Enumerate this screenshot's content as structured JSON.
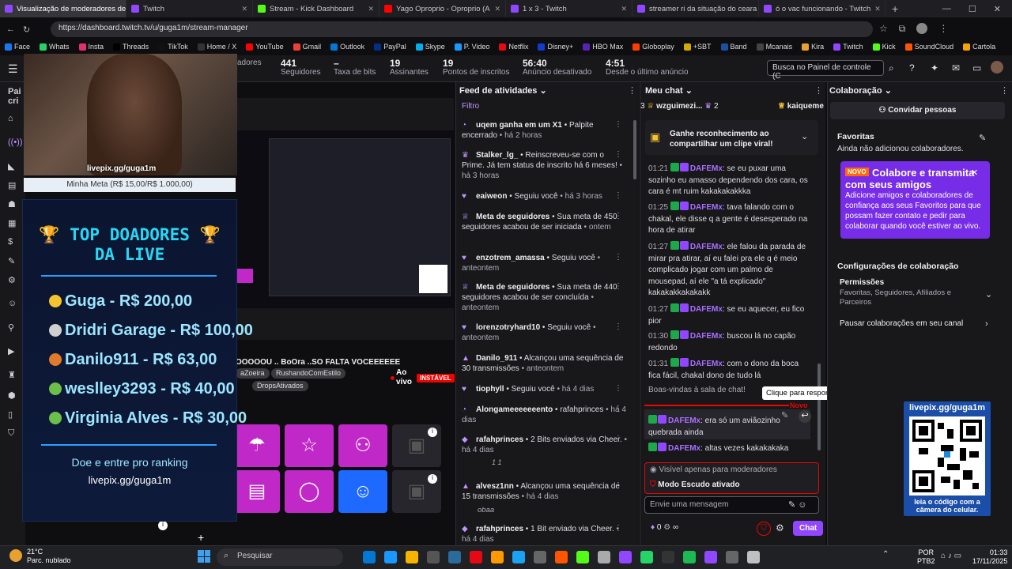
{
  "browser": {
    "tabs": [
      {
        "title": "Visualização de moderadores de",
        "color": "#9147ff",
        "active": true
      },
      {
        "title": "Twitch",
        "color": "#9147ff"
      },
      {
        "title": "Stream - Kick Dashboard",
        "color": "#53fc18"
      },
      {
        "title": "Yago Oproprio - Oproprio (A",
        "color": "#ff0000"
      },
      {
        "title": "1 x 3 - Twitch",
        "color": "#9147ff"
      },
      {
        "title": "streamer ri da situação do ceara",
        "color": "#9147ff"
      },
      {
        "title": "ó o vac funcionando - Twitch",
        "color": "#9147ff"
      }
    ],
    "url": "https://dashboard.twitch.tv/u/guga1m/stream-manager",
    "bookmarks": [
      "Face",
      "Whats",
      "Insta",
      "Threads",
      "TikTok",
      "Home / X",
      "YouTube",
      "Gmail",
      "Outlook",
      "PayPal",
      "Skype",
      "P. Video",
      "Netflix",
      "Disney+",
      "HBO Max",
      "Globoplay",
      "+SBT",
      "Band",
      "Mcanais",
      "Kira",
      "Twitch",
      "Kick",
      "SoundCloud",
      "Cartola"
    ]
  },
  "header": {
    "stats": [
      {
        "value": "",
        "label": "adores"
      },
      {
        "value": "441",
        "label": "Seguidores"
      },
      {
        "value": "–",
        "label": "Taxa de bits"
      },
      {
        "value": "19",
        "label": "Assinantes"
      },
      {
        "value": "19",
        "label": "Pontos de inscritos"
      },
      {
        "value": "56:40",
        "label": "Anúncio desativado"
      },
      {
        "value": "4:51",
        "label": "Desde o último anúncio"
      }
    ],
    "search_placeholder": "Busca no Painel de controle (C"
  },
  "overlay": {
    "cam_text": "livepix.gg/guga1m",
    "meta": "Minha Meta (R$ 15,00/R$ 1.000,00)",
    "donors_title_1": "🏆 TOP DOADORES 🏆",
    "donors_title_2": "DA LIVE",
    "donors": [
      {
        "text": "Guga - R$ 200,00",
        "medal": "#f4c430"
      },
      {
        "text": "Dridri Garage - R$ 100,00",
        "medal": "#cfcfcf"
      },
      {
        "text": "Danilo911 - R$ 63,00",
        "medal": "#e07b2a"
      },
      {
        "text": "weslley3293 - R$ 40,00",
        "medal": "#6cc04a"
      },
      {
        "text": "Virginia Alves - R$ 30,00",
        "medal": "#6cc04a"
      }
    ],
    "footer_1": "Doe e entre pro ranking",
    "footer_2": "livepix.gg/guga1m"
  },
  "preview": {
    "title": "OOOOOU .. BoOra ..SO FALTA VOCEEEEEE",
    "tags": [
      "aZoeira",
      "RushandoComEstilo",
      "DropsAtivados"
    ],
    "live": "Ao vivo",
    "unstable": "INSTÁVEL"
  },
  "feed": {
    "title": "Feed de atividades",
    "filter": "Filtro",
    "items": [
      {
        "icon": "◔",
        "user": "uqem ganha em um X1",
        "text": " • Palpite encerrado",
        "time": " • há 2 horas"
      },
      {
        "icon": "♛",
        "user": "Stalker_lg_",
        "text": " • Reinscreveu-se com o Prime. Já tem status de inscrito há 6 meses!",
        "time": " • há 3 horas"
      },
      {
        "icon": "♥",
        "user": "eaiweon",
        "text": " • Seguiu você",
        "time": " • há 3 horas"
      },
      {
        "icon": "♕",
        "user": "Meta de seguidores",
        "text": " • Sua meta de 450 seguidores acabou de ser iniciada",
        "time": " • ontem"
      },
      {
        "icon": "♥",
        "user": "enzotrem_amassa",
        "text": " • Seguiu você",
        "time": " • anteontem"
      },
      {
        "icon": "♕",
        "user": "Meta de seguidores",
        "text": " • Sua meta de 440 seguidores acabou de ser concluída",
        "time": " • anteontem"
      },
      {
        "icon": "♥",
        "user": "lorenzotryhard10",
        "text": " • Seguiu você",
        "time": " • anteontem"
      },
      {
        "icon": "▲",
        "user": "Danilo_911",
        "text": " • Alcançou uma sequência de 30 transmissões",
        "time": " • anteontem"
      },
      {
        "icon": "♥",
        "user": "tiophyll",
        "text": " • Seguiu você",
        "time": " • há 4 dias"
      },
      {
        "icon": "◔",
        "user": "Alongameeeeeeento",
        "text": " • rafahprinces",
        "time": " • há 4 dias"
      },
      {
        "icon": "◆",
        "user": "rafahprinces",
        "text": " • 2 Bits enviados via Cheer.",
        "time": " • há 4 dias"
      },
      {
        "icon": "▲",
        "user": "alvesz1nn",
        "text": " • Alcançou uma sequência de 15 transmissões",
        "time": " • há 4 dias"
      },
      {
        "icon": "◆",
        "user": "rafahprinces",
        "text": " • 1 Bit enviado via Cheer.",
        "time": " • há 4 dias"
      }
    ],
    "cheer_1": "1   1",
    "obaa": "obaa"
  },
  "chat": {
    "title": "Meu chat",
    "top_users": [
      "3",
      "wzguimezi...",
      "2",
      "kaiqueme"
    ],
    "pinned": "Ganhe reconhecimento ao compartilhar um clipe viral!",
    "messages": [
      {
        "ts": "01:21",
        "user": "DAFEMx",
        "text": ": se eu puxar uma sozinho eu amasso dependendo dos cara, os cara é mt ruim kakakakakkka"
      },
      {
        "ts": "01:25",
        "user": "DAFEMx",
        "text": ": tava falando com o chakal, ele disse q a gente é desesperado na hora de atirar"
      },
      {
        "ts": "01:27",
        "user": "DAFEMx",
        "text": ": ele falou da parada de mirar pra atirar, aí eu falei pra ele q é meio complicado jogar com um palmo de mousepad, aí ele \"a tá explicado\" kakakakkakakakk"
      },
      {
        "ts": "01:27",
        "user": "DAFEMx",
        "text": ": se eu aquecer, eu fico pior"
      },
      {
        "ts": "01:30",
        "user": "DAFEMx",
        "text": ": buscou lá no capão redondo"
      },
      {
        "ts": "01:31",
        "user": "DAFEMx",
        "text": ": com o dono da boca fica fácil, chakal dono de tudo lá"
      }
    ],
    "welcome": "Boas-vindas à sala de chat!",
    "tooltip": "Clique para responder",
    "new": "Novo",
    "reply_1": {
      "user": "DAFEMx",
      "text": ": era só um aviãozinho quebrada ainda"
    },
    "reply_2": {
      "user": "DAFEMx",
      "text": ": altas vezes kakakakaka"
    },
    "mod_visible": "Visível apenas para moderadores",
    "shield": "Modo Escudo ativado",
    "input_placeholder": "Envie uma mensagem",
    "points": "0",
    "infinity": "∞",
    "send": "Chat"
  },
  "collab": {
    "title": "Colaboração",
    "invite": "Convidar pessoas",
    "favorites_title": "Favoritas",
    "favorites_empty": "Ainda não adicionou colaboradores.",
    "promo_new": "NOVO",
    "promo_title": "Colabore e transmita com seus amigos",
    "promo_body": "Adicione amigos e colaboradores de confiança aos seus Favoritos para que possam fazer contato e pedir para colaborar quando você estiver ao vivo.",
    "config_title": "Configurações de colaboração",
    "permissions": "Permissões",
    "permissions_sub": "Favoritas, Seguidores, Afiliados e Parceiros",
    "pause": "Pausar colaborações em seu canal",
    "qr_title": "livepix.gg/guga1m",
    "qr_footer": "leia o código com a câmera do celular."
  },
  "taskbar": {
    "weather_temp": "21°C",
    "weather_desc": "Parc. nublado",
    "search": "Pesquisar",
    "lang_1": "POR",
    "lang_2": "PTB2",
    "time": "01:33",
    "date": "17/11/2025"
  }
}
